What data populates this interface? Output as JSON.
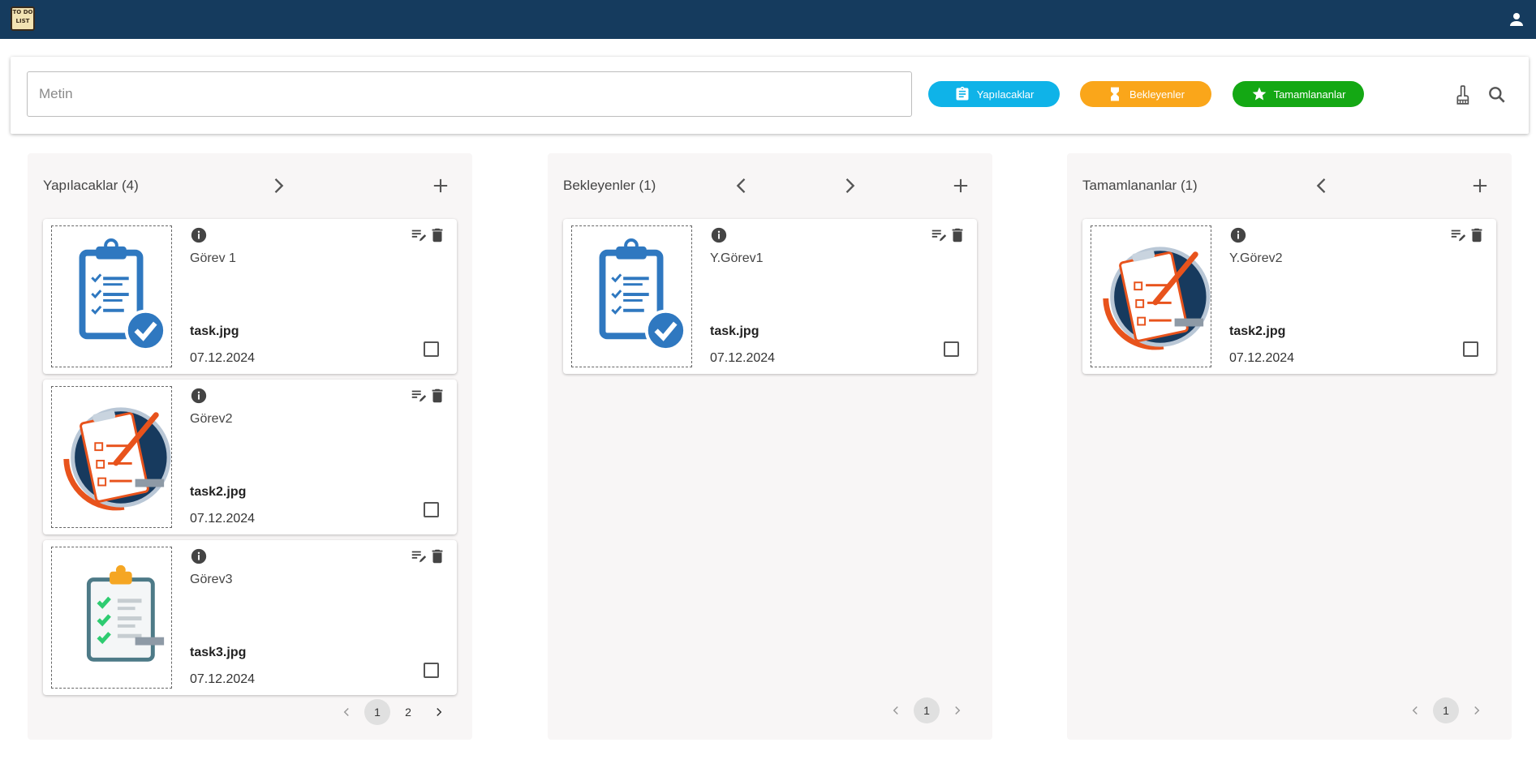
{
  "app": {
    "logo_line1": "TO DO",
    "logo_line2": "LIST"
  },
  "search": {
    "placeholder": "Metin",
    "value": ""
  },
  "filters": [
    {
      "label": "Yapılacaklar",
      "icon": "clipboard-icon",
      "color": "#0fb3e8"
    },
    {
      "label": "Bekleyenler",
      "icon": "hourglass-icon",
      "color": "#faa61a"
    },
    {
      "label": "Tamamlananlar",
      "icon": "star-icon",
      "color": "#14a814"
    }
  ],
  "columns": [
    {
      "title": "Yapılacaklar (4)",
      "cards": [
        {
          "title": "Görev 1",
          "file": "task.jpg",
          "date": "07.12.2024",
          "image": "blue-clipboard-check"
        },
        {
          "title": "Görev2",
          "file": "task2.jpg",
          "date": "07.12.2024",
          "image": "orange-clipboard-pencil"
        },
        {
          "title": "Görev3",
          "file": "task3.jpg",
          "date": "07.12.2024",
          "image": "green-clipboard-checklist"
        }
      ],
      "pages": [
        "1",
        "2"
      ],
      "active_page": "1"
    },
    {
      "title": "Bekleyenler (1)",
      "cards": [
        {
          "title": "Y.Görev1",
          "file": "task.jpg",
          "date": "07.12.2024",
          "image": "blue-clipboard-check"
        }
      ],
      "pages": [
        "1"
      ],
      "active_page": "1"
    },
    {
      "title": "Tamamlananlar (1)",
      "cards": [
        {
          "title": "Y.Görev2",
          "file": "task2.jpg",
          "date": "07.12.2024",
          "image": "orange-clipboard-pencil"
        }
      ],
      "pages": [
        "1"
      ],
      "active_page": "1"
    }
  ]
}
